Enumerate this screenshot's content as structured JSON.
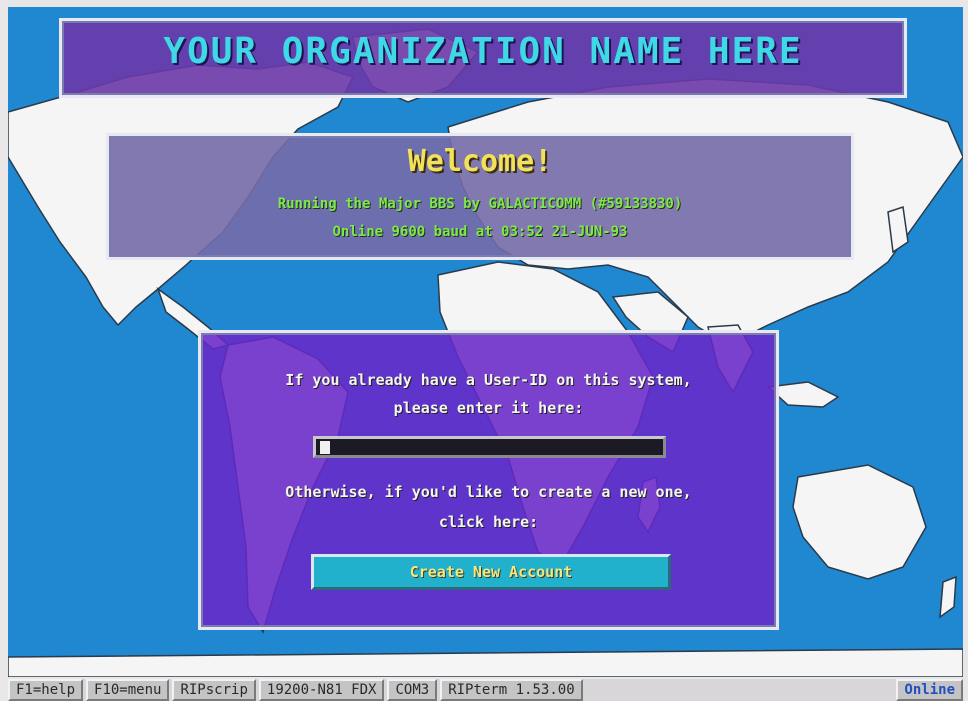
{
  "organization": {
    "name": "YOUR ORGANIZATION NAME HERE"
  },
  "welcome": {
    "title": "Welcome!",
    "line1": "Running the Major BBS by GALACTICOMM (#59133830)",
    "line2": "Online  9600 baud at 03:52 21-JUN-93"
  },
  "login": {
    "prompt_line1": "If you already have a User-ID on this system,",
    "prompt_line2": "please enter it here:",
    "userid_value": "",
    "create_line1": "Otherwise, if you'd like to create a new one,",
    "create_line2": "click here:",
    "create_button_label": "Create New Account"
  },
  "statusbar": {
    "items": [
      "F1=help",
      "F10=menu",
      "RIPscrip",
      "19200-N81 FDX",
      "COM3",
      "RIPterm 1.53.00",
      "Online"
    ]
  },
  "colors": {
    "ocean": "#1f88d0",
    "land": "#f4f4f4",
    "org_panel": "#6c38aa",
    "org_text": "#3ed8e6",
    "welcome_panel": "#766ca8",
    "welcome_title": "#f2e25a",
    "welcome_text": "#7ee84e",
    "login_panel": "#6828c8",
    "button": "#21b1cc",
    "button_text": "#f0e880"
  }
}
